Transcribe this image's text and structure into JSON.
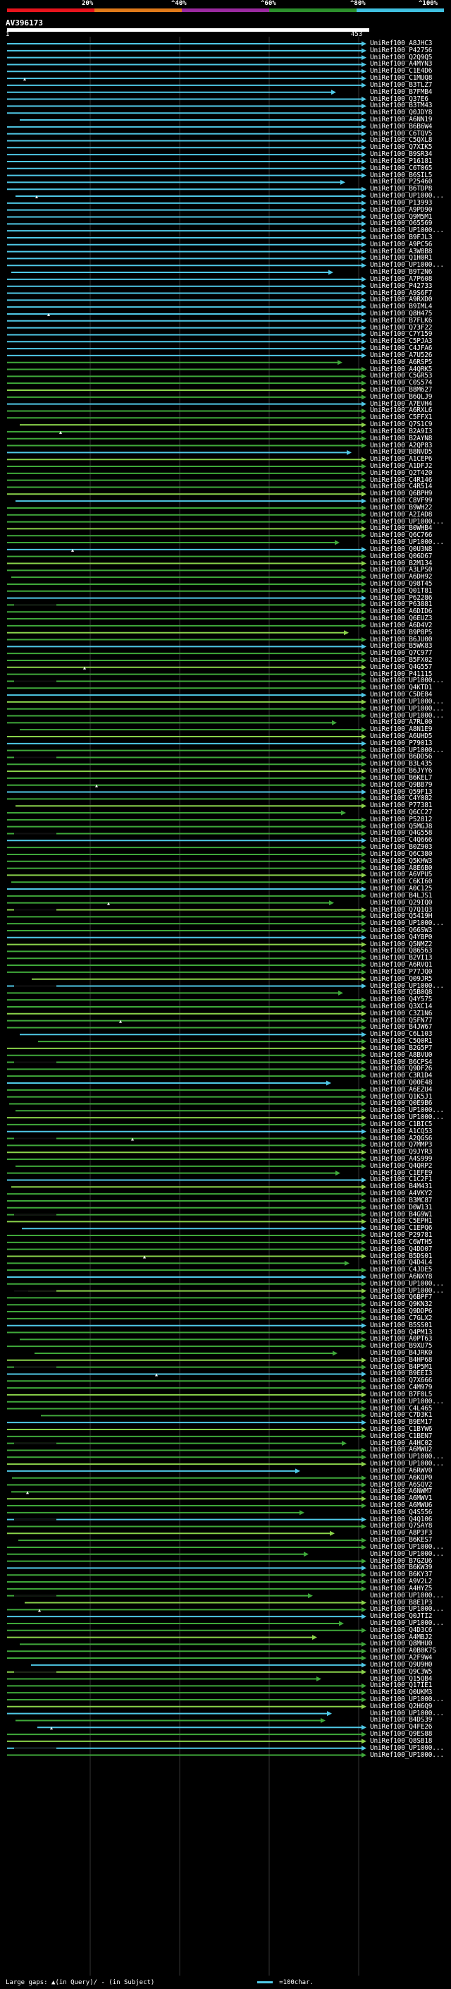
{
  "query": {
    "title": "AV396173",
    "start": "1",
    "end": "453"
  },
  "legend": {
    "labels": [
      "20%",
      "^40%",
      "^60%",
      "^80%",
      "^100%"
    ],
    "colors": [
      "#e8141c",
      "#e07a1a",
      "#9b2aa0",
      "#2c8f2c",
      "#40c0e0"
    ]
  },
  "colors": {
    "high": "#4fc8e6",
    "mid": "#3fa83a",
    "low": "#8ad24a"
  },
  "footer": {
    "gaps": "Large gaps: ▲(in Query)/ - (in Subject)",
    "key": "=100char."
  },
  "hits": [
    "UniRef100_A8JHC3",
    "UniRef100_P42756",
    "UniRef100_Q2Q9Q5",
    "UniRef100_A4MYN3",
    "UniRef100_C1E4D6",
    "UniRef100_C1MUQ8",
    "UniRef100_B3TLZ7",
    "UniRef100_B7FMB4",
    "UniRef100_Q37E6",
    "UniRef100_B3TM43",
    "UniRef100_Q0JDY8",
    "UniRef100_A6NN19",
    "UniRef100_B6B6W4",
    "UniRef100_C6TQV5",
    "UniRef100_C5QXL8",
    "UniRef100_Q7XIK5",
    "UniRef100_B9SR34",
    "UniRef100_P16181",
    "UniRef100_C6T065",
    "UniRef100_B6SIL5",
    "UniRef100_P25460",
    "UniRef100_B6TDP8",
    "UniRef100_UP1000...",
    "UniRef100_P13993",
    "UniRef100_A9PD90",
    "UniRef100_Q9M5M1",
    "UniRef100_O65569",
    "UniRef100_UP1000...",
    "UniRef100_B9FJL3",
    "UniRef100_A9PC56",
    "UniRef100_A3W8B8",
    "UniRef100_Q1H0R1",
    "UniRef100_UP1000...",
    "UniRef100_B9T2N6",
    "UniRef100_A7P608",
    "UniRef100_P42733",
    "UniRef100_A9S6F7",
    "UniRef100_A9RXD0",
    "UniRef100_B9IML4",
    "UniRef100_Q8H475",
    "UniRef100_B7FLK6",
    "UniRef100_Q73F22",
    "UniRef100_C7Y159",
    "UniRef100_C5PJA3",
    "UniRef100_C4JFA6",
    "UniRef100_A7U526",
    "UniRef100_A6RSP5",
    "UniRef100_A4QRK5",
    "UniRef100_C5GR53",
    "UniRef100_C0S574",
    "UniRef100_B8M627",
    "UniRef100_B6QLJ9",
    "UniRef100_A7EVH4",
    "UniRef100_A6RXL6",
    "UniRef100_C5FFX1",
    "UniRef100_Q7S1C9",
    "UniRef100_B2A9I3",
    "UniRef100_B2AYN8",
    "UniRef100_A2QP83",
    "UniRef100_B8NVD5",
    "UniRef100_A1CEP6",
    "UniRef100_A1DFJ2",
    "UniRef100_Q2T420",
    "UniRef100_C4R146",
    "UniRef100_C4R514",
    "UniRef100_Q6BPH9",
    "UniRef100_C8VF99",
    "UniRef100_B9WH22",
    "UniRef100_A2IAD8",
    "UniRef100_UP1000...",
    "UniRef100_B0WHB4",
    "UniRef100_Q6C766",
    "UniRef100_UP1000...",
    "UniRef100_Q0U3N8",
    "UniRef100_Q06D67",
    "UniRef100_B2M134",
    "UniRef100_A3LPS0",
    "UniRef100_A6DH92",
    "UniRef100_Q98T45",
    "UniRef100_Q01T81",
    "UniRef100_P62286",
    "UniRef100_P63881",
    "UniRef100_A6DID6",
    "UniRef100_Q6EUZ3",
    "UniRef100_A6D4V2",
    "UniRef100_B9P8P5",
    "UniRef100_B6JU00",
    "UniRef100_B5WK83",
    "UniRef100_Q7C977",
    "UniRef100_B5FX02",
    "UniRef100_Q4G557",
    "UniRef100_P41115",
    "UniRef100_UP1000...",
    "UniRef100_Q4KTD1",
    "UniRef100_C5DE84",
    "UniRef100_UP1000...",
    "UniRef100_UP1000...",
    "UniRef100_UP1000...",
    "UniRef100_A7RL00",
    "UniRef100_A8N1E9",
    "UniRef100_A6UHD5",
    "UniRef100_P79013",
    "UniRef100_UP1000...",
    "UniRef100_B6DD56",
    "UniRef100_B3L435",
    "UniRef100_B6JYY6",
    "UniRef100_B6KEL7",
    "UniRef100_Q9BB79",
    "UniRef100_Q59F13",
    "UniRef100_C4Y082",
    "UniRef100_P77381",
    "UniRef100_Q6CC27",
    "UniRef100_P52812",
    "UniRef100_Q5MGJ8",
    "UniRef100_Q4G558",
    "UniRef100_C4Q666",
    "UniRef100_B0Z903",
    "UniRef100_Q6C380",
    "UniRef100_Q5KHW3",
    "UniRef100_A8E6B0",
    "UniRef100_A6VPU5",
    "UniRef100_C6KI60",
    "UniRef100_A0C125",
    "UniRef100_B4LJS1",
    "UniRef100_Q29IQ0",
    "UniRef100_Q7Q1Q3",
    "UniRef100_Q5419H",
    "UniRef100_UP1000...",
    "UniRef100_Q66SW3",
    "UniRef100_Q4YBP0",
    "UniRef100_Q5NMZ2",
    "UniRef100_Q86563",
    "UniRef100_B2VI13",
    "UniRef100_A6RVQ1",
    "UniRef100_P77JQ0",
    "UniRef100_Q09JR5",
    "UniRef100_UP1000...",
    "UniRef100_Q5B0Q8",
    "UniRef100_Q4Y575",
    "UniRef100_Q3XC14",
    "UniRef100_C3Z1N6",
    "UniRef100_Q5FN77",
    "UniRef100_B4JW67",
    "UniRef100_C6L103",
    "UniRef100_C5Q0R1",
    "UniRef100_B2G5P7",
    "UniRef100_A8BVU0",
    "UniRef100_B6CPS4",
    "UniRef100_Q9DF26",
    "UniRef100_C3R1D4",
    "UniRef100_Q00E48",
    "UniRef100_A6EZU4",
    "UniRef100_Q1K5J1",
    "UniRef100_Q0E9B6",
    "UniRef100_UP1000...",
    "UniRef100_UP1000...",
    "UniRef100_C1BIC5",
    "UniRef100_A1CQ53",
    "UniRef100_A2QGS6",
    "UniRef100_Q7MMP3",
    "UniRef100_Q9JYR3",
    "UniRef100_A4S999",
    "UniRef100_Q4QRP2",
    "UniRef100_C1EFE9",
    "UniRef100_C1C2F1",
    "UniRef100_B4M431",
    "UniRef100_A4VKY2",
    "UniRef100_B3MC87",
    "UniRef100_D0W131",
    "UniRef100_B4G9W1",
    "UniRef100_C5EPH1",
    "UniRef100_C1EPQ6",
    "UniRef100_P29781",
    "UniRef100_C6WTH5",
    "UniRef100_Q4DD07",
    "UniRef100_B5DS01",
    "UniRef100_Q4D4L4",
    "UniRef100_C4JDE5",
    "UniRef100_A6NXY8",
    "UniRef100_UP1000...",
    "UniRef100_UP1000...",
    "UniRef100_Q6BPF7",
    "UniRef100_Q9KN32",
    "UniRef100_Q9DDP6",
    "UniRef100_C7GLX2",
    "UniRef100_B5SS01",
    "UniRef100_Q4PM13",
    "UniRef100_A0PT63",
    "UniRef100_B9XU75",
    "UniRef100_B4JRK0",
    "UniRef100_B4HP68",
    "UniRef100_B4P5M1",
    "UniRef100_B9EEI3",
    "UniRef100_Q7X666",
    "UniRef100_C4M979",
    "UniRef100_B7F0L5",
    "UniRef100_UP1000...",
    "UniRef100_C4L465",
    "UniRef100_C7D3K1",
    "UniRef100_B9EM17",
    "UniRef100_C1BYW6",
    "UniRef100_C1BEN7",
    "UniRef100_A4HC02",
    "UniRef100_A6MWU2",
    "UniRef100_UP1000...",
    "UniRef100_UP1000...",
    "UniRef100_A6RWV0",
    "UniRef100_A6KQP0",
    "UniRef100_A6SQV2",
    "UniRef100_A6NWM7",
    "UniRef100_A6MWV1",
    "UniRef100_A6MWU6",
    "UniRef100_Q4S556",
    "UniRef100_Q4Q106",
    "UniRef100_Q7SAY8",
    "UniRef100_A8P3F3",
    "UniRef100_B6KES7",
    "UniRef100_UP1000...",
    "UniRef100_UP1000...",
    "UniRef100_B7GZU6",
    "UniRef100_B6KW39",
    "UniRef100_B6KY37",
    "UniRef100_A9V2L2",
    "UniRef100_A4HYZ5",
    "UniRef100_UP1000...",
    "UniRef100_B8E1P3",
    "UniRef100_UP1000...",
    "UniRef100_Q0JTI2",
    "UniRef100_UP1000...",
    "UniRef100_Q4D3C6",
    "UniRef100_A4MBJ2",
    "UniRef100_Q8MHU0",
    "UniRef100_A0B0K7S",
    "UniRef100_A2F9W4",
    "UniRef100_Q9U9H0",
    "UniRef100_Q9C3W5",
    "UniRef100_Q15QB4",
    "UniRef100_Q17IE1",
    "UniRef100_Q0UKM3",
    "UniRef100_UP1000...",
    "UniRef100_Q2H6Q9",
    "UniRef100_UP1000...",
    "UniRef100_B4DS39",
    "UniRef100_Q4FE26",
    "UniRef100_Q9ES88",
    "UniRef100_Q8SB18",
    "UniRef100_UP1000...",
    "UniRef100_UP1000..."
  ]
}
